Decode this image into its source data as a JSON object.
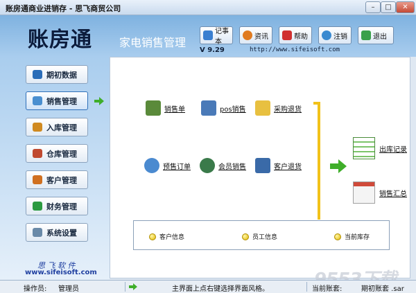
{
  "window": {
    "title": "账房通商业进销存 - 思飞商贸公司",
    "minimize_glyph": "–",
    "maximize_glyph": "□",
    "close_glyph": "✕"
  },
  "header": {
    "logo": "账房通",
    "subtitle": "家电销售管理",
    "version": "V 9.29",
    "url": "http://www.sifeisoft.com",
    "buttons": [
      {
        "label": "记事本",
        "icon": "notepad-icon",
        "color": "#3a7fd0"
      },
      {
        "label": "资讯",
        "icon": "globe-icon",
        "color": "#e07b20"
      },
      {
        "label": "帮助",
        "icon": "help-icon",
        "color": "#d03030"
      },
      {
        "label": "注销",
        "icon": "logout-user-icon",
        "color": "#3a8ad0"
      },
      {
        "label": "退出",
        "icon": "exit-icon",
        "color": "#3aa04a"
      }
    ]
  },
  "sidebar": {
    "items": [
      {
        "label": "期初数据",
        "icon": "book-icon",
        "color": "#2a6db8"
      },
      {
        "label": "销售管理",
        "icon": "sales-icon",
        "color": "#4a8fd0",
        "active": true
      },
      {
        "label": "入库管理",
        "icon": "box-icon",
        "color": "#d08a20"
      },
      {
        "label": "仓库管理",
        "icon": "warehouse-icon",
        "color": "#c04a30"
      },
      {
        "label": "客户管理",
        "icon": "customer-icon",
        "color": "#d07020"
      },
      {
        "label": "财务管理",
        "icon": "finance-icon",
        "color": "#2a9a40"
      },
      {
        "label": "系统设置",
        "icon": "settings-icon",
        "color": "#6a8aa8"
      }
    ],
    "brand_cn": "思 飞 软 件",
    "brand_url": "www.sifeisoft.com"
  },
  "main": {
    "items": [
      {
        "label": "销售单",
        "icon": "sales-slip-icon",
        "color": "#5a8a3a"
      },
      {
        "label": "pos销售",
        "icon": "pos-monitor-icon",
        "color": "#4a7ab8"
      },
      {
        "label": "采购退货",
        "icon": "folder-return-icon",
        "color": "#e8c040"
      },
      {
        "label": "预售订单",
        "icon": "clock-order-icon",
        "color": "#4a8ad0"
      },
      {
        "label": "会员销售",
        "icon": "members-icon",
        "color": "#3a7a4a"
      },
      {
        "label": "客户退货",
        "icon": "return-card-icon",
        "color": "#3a6aa8"
      }
    ],
    "right_items": [
      {
        "label": "出库记录",
        "icon": "spreadsheet-icon",
        "color": "#5aaa4a"
      },
      {
        "label": "销售汇总",
        "icon": "report-icon",
        "color": "#d04a3a"
      }
    ],
    "info": [
      {
        "label": "客户信息"
      },
      {
        "label": "员工信息"
      },
      {
        "label": "当前库存"
      }
    ]
  },
  "statusbar": {
    "operator_label": "操作员:",
    "operator_value": "管理员",
    "hint": "主界面上点右键选择界面风格。",
    "current_book_label": "当前账套:",
    "period_label": "期初账套 .sar"
  },
  "watermark": "9553下载",
  "colors": {
    "accent_green": "#3fae2a",
    "divider_yellow": "#f2c21a"
  }
}
